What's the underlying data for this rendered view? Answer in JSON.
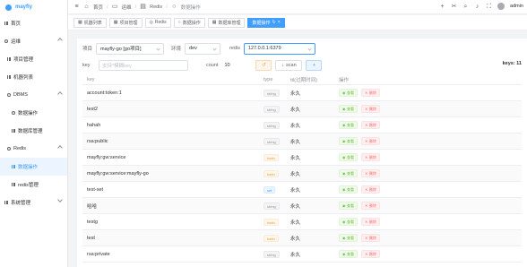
{
  "app": {
    "logo_text": "mayfly"
  },
  "sidebar": {
    "items": [
      {
        "label": "首页",
        "icon": "home-icon",
        "level": 0
      },
      {
        "label": "运维",
        "icon": "ops-icon",
        "level": 0,
        "expanded": true
      },
      {
        "label": "项目管理",
        "icon": "grid-icon",
        "level": 1
      },
      {
        "label": "机器列表",
        "icon": "grid-icon",
        "level": 1
      },
      {
        "label": "DBMS",
        "icon": "db-icon",
        "level": 1,
        "expanded": true
      },
      {
        "label": "数据操作",
        "icon": "circle-icon",
        "level": 2
      },
      {
        "label": "数据库管理",
        "icon": "grid-icon",
        "level": 2
      },
      {
        "label": "Redis",
        "icon": "redis-icon",
        "level": 1,
        "expanded": true
      },
      {
        "label": "数据操作",
        "icon": "grid-icon",
        "level": 2,
        "active": true
      },
      {
        "label": "redis管理",
        "icon": "grid-icon",
        "level": 2
      },
      {
        "label": "系统管理",
        "icon": "settings-icon",
        "level": 0
      }
    ]
  },
  "header": {
    "breadcrumb": [
      "首页",
      "运维",
      "Redis",
      "数据操作"
    ],
    "user": "admin"
  },
  "tabs": [
    {
      "label": "机器列表"
    },
    {
      "label": "项目管理"
    },
    {
      "label": "Redis"
    },
    {
      "label": "数据操作"
    },
    {
      "label": "数据库管理"
    },
    {
      "label": "数据操作",
      "active": true
    }
  ],
  "filters": {
    "project_label": "项目",
    "project_value": "mayfly-go [go项目]",
    "env_label": "环境",
    "env_value": "dev",
    "redis_label": "redis",
    "redis_value": "127.0.0.1:6379",
    "key_label": "key",
    "key_placeholder": "支持*模糊key",
    "count_label": "count",
    "count_value": "10",
    "scan_label": "scan",
    "keys_count": "keys: 11"
  },
  "table": {
    "headers": {
      "key": "key",
      "type": "type",
      "ttl": "ttl(过期时间)",
      "op": "操作"
    },
    "view_label": "查看",
    "delete_label": "删除",
    "rows": [
      {
        "key": "account:token:1",
        "type": "string",
        "ttl": "永久"
      },
      {
        "key": "test2",
        "type": "string",
        "ttl": "永久"
      },
      {
        "key": "hahah",
        "type": "string",
        "ttl": "永久"
      },
      {
        "key": "rsa:public",
        "type": "string",
        "ttl": "永久"
      },
      {
        "key": "mayfly:gw:service",
        "type": "hash",
        "ttl": "永久"
      },
      {
        "key": "mayfly:gw:service:mayfly-go",
        "type": "hash",
        "ttl": "永久"
      },
      {
        "key": "test-set",
        "type": "set",
        "ttl": "永久"
      },
      {
        "key": "哈哈",
        "type": "string",
        "ttl": "永久"
      },
      {
        "key": "testg",
        "type": "hash",
        "ttl": "永久"
      },
      {
        "key": "test",
        "type": "hash",
        "ttl": "永久"
      },
      {
        "key": "rsa:private",
        "type": "string",
        "ttl": "永久"
      }
    ]
  }
}
